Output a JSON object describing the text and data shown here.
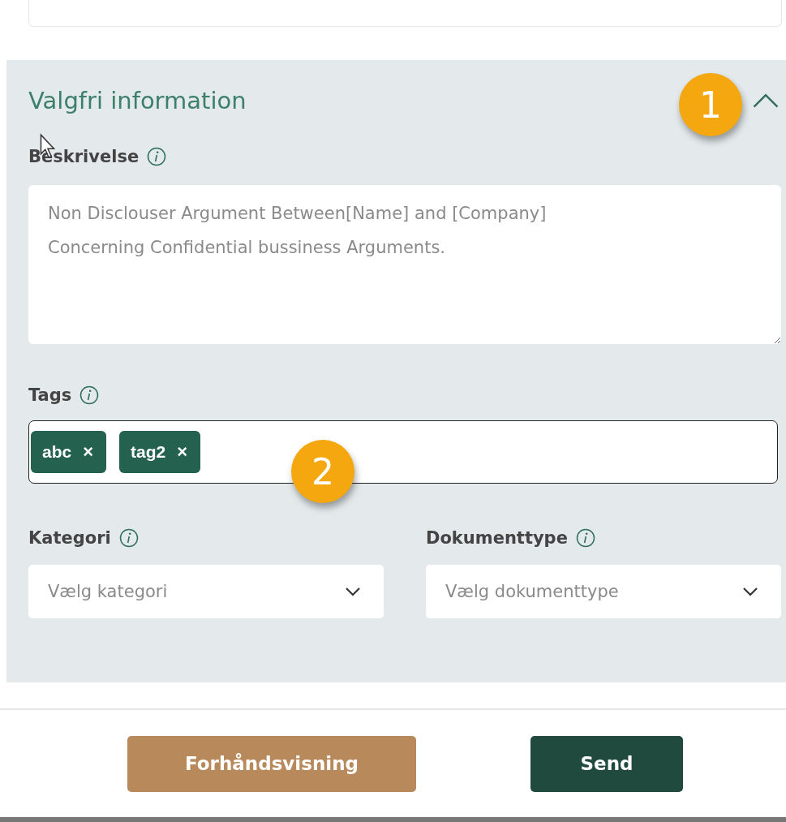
{
  "section": {
    "title": "Valgfri information",
    "expanded": true,
    "description": {
      "label": "Beskrivelse",
      "placeholder": "Non Disclouser Argument Between[Name] and [Company] Concerning Confidential bussiness Arguments."
    },
    "tags": {
      "label": "Tags",
      "items": [
        {
          "text": "abc",
          "remove": "×"
        },
        {
          "text": "tag2",
          "remove": "×"
        }
      ]
    },
    "selects": [
      {
        "label": "Kategori",
        "placeholder": "Vælg kategori"
      },
      {
        "label": "Dokumenttype",
        "placeholder": "Vælg dokumenttype"
      }
    ]
  },
  "callouts": [
    "1",
    "2"
  ],
  "buttons": [
    {
      "kind": "secondary",
      "label": "Forhåndsvisning"
    },
    {
      "kind": "primary",
      "label": "Send"
    }
  ]
}
